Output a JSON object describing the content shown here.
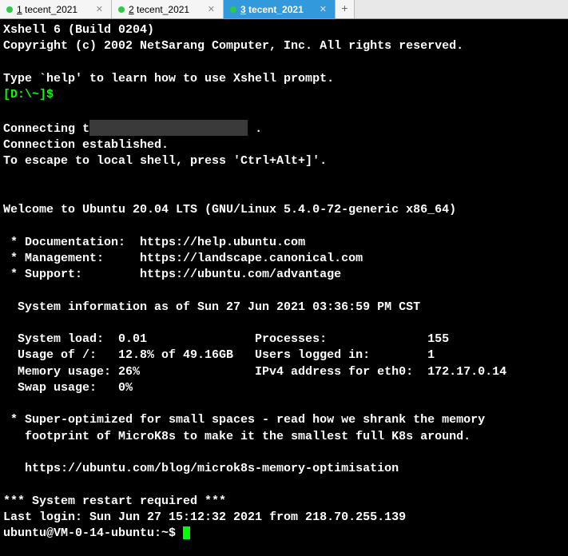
{
  "tabs": [
    {
      "num": "1",
      "label": "tecent_2021",
      "active": false
    },
    {
      "num": "2",
      "label": "tecent_2021",
      "active": false
    },
    {
      "num": "3",
      "label": "tecent_2021",
      "active": true
    }
  ],
  "header_line": "Xshell 6 (Build 0204)",
  "copyright": "Copyright (c) 2002 NetSarang Computer, Inc. All rights reserved.",
  "help_line": "Type `help' to learn how to use Xshell prompt.",
  "local_prompt": "[D:\\~]$",
  "connecting_prefix": "Connecting t",
  "connecting_suffix": " .",
  "conn_established": "Connection established.",
  "escape_line": "To escape to local shell, press 'Ctrl+Alt+]'.",
  "welcome": "Welcome to Ubuntu 20.04 LTS (GNU/Linux 5.4.0-72-generic x86_64)",
  "links": {
    "doc_label": " * Documentation:  ",
    "doc_url": "https://help.ubuntu.com",
    "mgmt_label": " * Management:     ",
    "mgmt_url": "https://landscape.canonical.com",
    "sup_label": " * Support:        ",
    "sup_url": "https://ubuntu.com/advantage"
  },
  "sysinfo_header": "  System information as of Sun 27 Jun 2021 03:36:59 PM CST",
  "stats": {
    "row1": "  System load:  0.01               Processes:              155",
    "row2": "  Usage of /:   12.8% of 49.16GB   Users logged in:        1",
    "row3": "  Memory usage: 26%                IPv4 address for eth0:  172.17.0.14",
    "row4": "  Swap usage:   0%"
  },
  "promo1": " * Super-optimized for small spaces - read how we shrank the memory",
  "promo2": "   footprint of MicroK8s to make it the smallest full K8s around.",
  "promo_url": "   https://ubuntu.com/blog/microk8s-memory-optimisation",
  "restart": "*** System restart required ***",
  "last_login": "Last login: Sun Jun 27 15:12:32 2021 from 218.70.255.139",
  "shell_prompt": "ubuntu@VM-0-14-ubuntu:~$ "
}
